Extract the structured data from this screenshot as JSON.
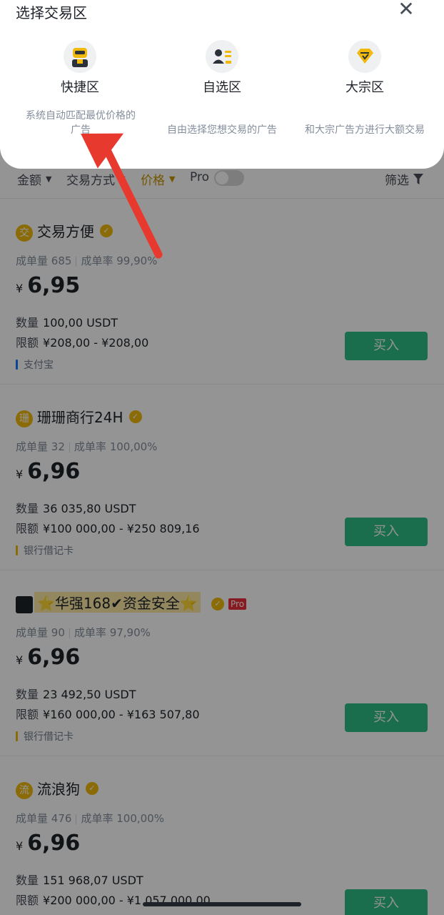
{
  "sheet": {
    "title": "选择交易区",
    "zones": [
      {
        "label": "快捷区",
        "desc": "系统自动匹配最优价格的广告",
        "icon": "robot-icon"
      },
      {
        "label": "自选区",
        "desc": "自由选择您想交易的广告",
        "icon": "user-card-icon"
      },
      {
        "label": "大宗区",
        "desc": "和大宗广告方进行大额交易",
        "icon": "diamond-icon"
      }
    ],
    "close_icon": "close-icon"
  },
  "filters": {
    "amount": "金额",
    "method": "交易方式",
    "price": "价格",
    "pro": "Pro",
    "screen": "筛选",
    "active_color": "#c99400"
  },
  "ads": [
    {
      "avatar": "交",
      "name": "交易方便",
      "orders_label": "成单量",
      "orders": "685",
      "rate_label": "成单率",
      "rate": "99,90%",
      "currency": "¥",
      "price": "6,95",
      "qty_label": "数量",
      "qty": "100,00 USDT",
      "limit_label": "限额",
      "limit": "¥208,00 - ¥208,00",
      "pay": "支付宝",
      "buy": "买入"
    },
    {
      "avatar": "珊",
      "name": "珊珊商行24H",
      "orders_label": "成单量",
      "orders": "32",
      "rate_label": "成单率",
      "rate": "100,00%",
      "currency": "¥",
      "price": "6,96",
      "qty_label": "数量",
      "qty": "36 035,80 USDT",
      "limit_label": "限额",
      "limit": "¥100 000,00 - ¥250 809,16",
      "pay": "银行借记卡",
      "buy": "买入"
    },
    {
      "avatar": "",
      "name": "⭐华强168✔资金安全⭐",
      "badge": "Pro",
      "orders_label": "成单量",
      "orders": "90",
      "rate_label": "成单率",
      "rate": "97,90%",
      "currency": "¥",
      "price": "6,96",
      "qty_label": "数量",
      "qty": "23 492,50 USDT",
      "limit_label": "限额",
      "limit": "¥160 000,00 - ¥163 507,80",
      "pay": "银行借记卡",
      "buy": "买入"
    },
    {
      "avatar": "流",
      "name": "流浪狗",
      "orders_label": "成单量",
      "orders": "476",
      "rate_label": "成单率",
      "rate": "100,00%",
      "currency": "¥",
      "price": "6,96",
      "qty_label": "数量",
      "qty": "151 968,07 USDT",
      "limit_label": "限额",
      "limit": "¥200 000,00 - ¥1 057 000,00",
      "buy": "买入"
    }
  ],
  "colors": {
    "buy": "#2ebd85",
    "accent": "#f0b90b",
    "annotation_arrow": "#e8392f"
  }
}
